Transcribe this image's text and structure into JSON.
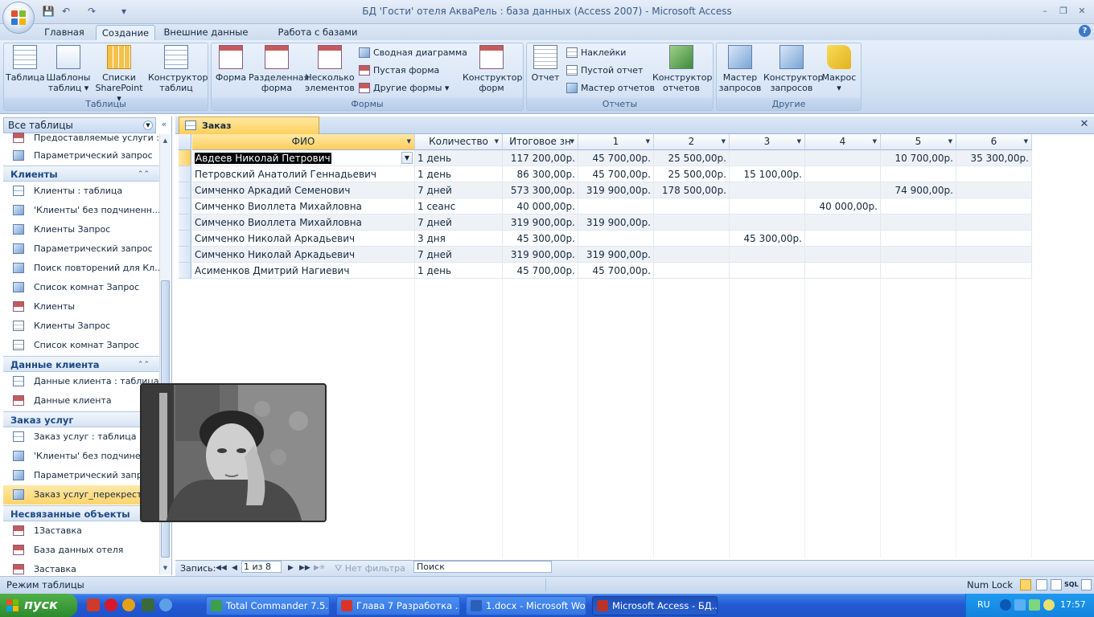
{
  "window": {
    "title": "БД 'Гости' отеля АкваРель : база данных (Access 2007) - Microsoft Access",
    "min_glyph": "–",
    "max_glyph": "❐",
    "close_glyph": "✕"
  },
  "qat": {
    "save_glyph": "💾",
    "undo_glyph": "↶",
    "redo_glyph": "↷",
    "more_glyph": "▾"
  },
  "tabs": [
    "Главная",
    "Создание",
    "Внешние данные",
    "Работа с базами данных"
  ],
  "ribbon": {
    "groups": {
      "tables": "Таблицы",
      "forms": "Формы",
      "reports": "Отчеты",
      "other": "Другие"
    },
    "tables": {
      "table": "Таблица",
      "templates_1": "Шаблоны",
      "templates_2": "таблиц ▾",
      "sharepoint_1": "Списки",
      "sharepoint_2": "SharePoint ▾",
      "designer_1": "Конструктор",
      "designer_2": "таблиц"
    },
    "forms": {
      "form": "Форма",
      "split_1": "Разделенная",
      "split_2": "форма",
      "multi_1": "Несколько",
      "multi_2": "элементов",
      "pivot_chart": "Сводная диаграмма",
      "blank_form": "Пустая форма",
      "other_forms": "Другие формы ▾",
      "designer_1": "Конструктор",
      "designer_2": "форм"
    },
    "reports": {
      "report": "Отчет",
      "labels": "Наклейки",
      "blank_report": "Пустой отчет",
      "wizard": "Мастер отчетов",
      "designer_1": "Конструктор",
      "designer_2": "отчетов"
    },
    "other": {
      "query_wizard_1": "Мастер",
      "query_wizard_2": "запросов",
      "query_designer_1": "Конструктор",
      "query_designer_2": "запросов",
      "macro_1": "Макрос",
      "macro_2": "▾"
    }
  },
  "nav": {
    "header": "Все таблицы",
    "collapse_glyph": "«",
    "items_top": [
      "Предоставляемые услуги :...",
      "Параметрический запрос"
    ],
    "groups": [
      {
        "title": "Клиенты",
        "items": [
          "Клиенты : таблица",
          "'Клиенты' без подчиненн...",
          "Клиенты Запрос",
          "Параметрический запрос",
          "Поиск повторений для Кл...",
          "Список комнат Запрос",
          "Клиенты",
          "Клиенты Запрос",
          "Список комнат Запрос"
        ]
      },
      {
        "title": "Данные клиента",
        "items": [
          "Данные клиента : таблица",
          "Данные клиента"
        ]
      },
      {
        "title": "Заказ услуг",
        "items": [
          "Заказ услуг : таблица",
          "'Клиенты' без подчиненн...",
          "Параметрический запрос",
          "Заказ услуг_перекрестный"
        ]
      },
      {
        "title": "Несвязанные объекты",
        "items": [
          "1Заставка",
          "База данных отеля",
          "Заставка"
        ]
      }
    ]
  },
  "document": {
    "tab_title": "Заказ услуг_перекрестный",
    "close_glyph": "✕"
  },
  "table": {
    "columns": [
      "ФИО",
      "Количество",
      "Итоговое зн",
      "1",
      "2",
      "3",
      "4",
      "5",
      "6"
    ],
    "rows": [
      [
        "Авдеев Николай Петрович",
        "1 день",
        "117 200,00р.",
        "45 700,00р.",
        "25 500,00р.",
        "",
        "",
        "10 700,00р.",
        "35 300,00р."
      ],
      [
        "Петровский Анатолий Геннадьевич",
        "1 день",
        "86 300,00р.",
        "45 700,00р.",
        "25 500,00р.",
        "15 100,00р.",
        "",
        "",
        ""
      ],
      [
        "Симченко Аркадий Семенович",
        "7 дней",
        "573 300,00р.",
        "319 900,00р.",
        "178 500,00р.",
        "",
        "",
        "74 900,00р.",
        ""
      ],
      [
        "Симченко Виоллета Михайловна",
        "1 сеанс",
        "40 000,00р.",
        "",
        "",
        "",
        "40 000,00р.",
        "",
        ""
      ],
      [
        "Симченко Виоллета Михайловна",
        "7 дней",
        "319 900,00р.",
        "319 900,00р.",
        "",
        "",
        "",
        "",
        ""
      ],
      [
        "Симченко Николай Аркадьевич",
        "3 дня",
        "45 300,00р.",
        "",
        "",
        "45 300,00р.",
        "",
        "",
        ""
      ],
      [
        "Симченко Николай Аркадьевич",
        "7 дней",
        "319 900,00р.",
        "319 900,00р.",
        "",
        "",
        "",
        "",
        ""
      ],
      [
        "Асименков Дмитрий Нагиевич",
        "1 день",
        "45 700,00р.",
        "45 700,00р.",
        "",
        "",
        "",
        "",
        ""
      ]
    ]
  },
  "record_bar": {
    "label": "Запись:",
    "first": "◀◀",
    "prev": "◀",
    "current": "1 из 8",
    "next": "▶",
    "last": "▶▶",
    "new": "▶✳",
    "filter": "Нет фильтра",
    "search": "Поиск"
  },
  "status": {
    "mode": "Режим таблицы",
    "numlock": "Num Lock"
  },
  "taskbar": {
    "start": "пуск",
    "buttons": [
      {
        "label": "Total Commander 7.5...",
        "color": "#3aa04a"
      },
      {
        "label": "Глава 7 Разработка ...",
        "color": "#d8342a"
      },
      {
        "label": "1.docx - Microsoft Word",
        "color": "#2b5fb8"
      },
      {
        "label": "Microsoft Access - БД...",
        "color": "#b8342a"
      }
    ],
    "lang": "RU",
    "clock": "17:57"
  },
  "colors": {
    "accent": "#ffcf5c",
    "ribbon": "#d2e1f3",
    "taskbar": "#2459d3"
  }
}
